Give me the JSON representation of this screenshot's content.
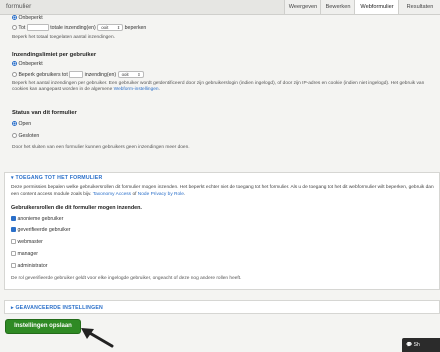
{
  "header": {
    "title": "formulier",
    "tabs": [
      "Weergeven",
      "Bewerken",
      "Webformulier",
      "Resultaten"
    ],
    "active_tab": "Webformulier"
  },
  "total_limit": {
    "unlimited_label": "Onbeperkt",
    "limit_prefix": "Tot",
    "limit_middle": "totale inzending(en)",
    "select_value": "ooit",
    "limit_suffix": "beperken",
    "description": "Beperk het totaal toegelaten aantal inzendingen."
  },
  "user_limit": {
    "heading": "Inzendingslimiet per gebruiker",
    "unlimited_label": "Onbeperkt",
    "limit_prefix": "Beperk gebruikers tot",
    "limit_middle": "inzending(en)",
    "select_value": "ooit",
    "description": "Beperk het aantal inzendingen per gebruiker. Een gebruiker wordt geïdentificeerd door zijn gebruikerslogin (indien ingelogd), of door zijn IP-adres en cookie (indien niet ingelogd). Het gebruik van cookies kan aangepast worden in de algemene",
    "description_link": "Webform-instellingen",
    "description_end": "."
  },
  "status": {
    "heading": "Status van dit formulier",
    "open_label": "Open",
    "closed_label": "Gesloten",
    "description": "Door het sluiten van een formulier kunnen gebruikers geen inzendingen meer doen."
  },
  "access": {
    "legend": "▾ TOEGANG TOT HET FORMULIER",
    "description_1": "Deze permissies bepalen welke gebruikersrollen dit formulier mogen inzenden. Het beperkt echter niet de toegang tot het formulier. Als u de toegang tot het dit webformulier wilt beperken, gebruik dan een content access module zoals bijv.",
    "link_1": "Taxonomy Access",
    "description_of": "of",
    "link_2": "Node Privacy by Role",
    "description_end": ".",
    "roles_heading": "Gebruikersrollen die dit formulier mogen inzenden.",
    "roles": [
      {
        "label": "anonieme gebruiker",
        "checked": true
      },
      {
        "label": "geverifieerde gebruiker",
        "checked": true
      },
      {
        "label": "webmaster",
        "checked": false
      },
      {
        "label": "manager",
        "checked": false
      },
      {
        "label": "administrator",
        "checked": false
      }
    ],
    "note": "De rol geverifieerde gebruiker geldt voor elke ingelogde gebruiker, ongeacht of deze nog andere rollen heeft."
  },
  "advanced": {
    "legend": "▸ GEAVANCEERDE INSTELLINGEN"
  },
  "save_button": "Instellingen opslaan",
  "chat_button": "Sh",
  "colors": {
    "accent": "#2a6fc9",
    "save": "#2f8a24"
  }
}
